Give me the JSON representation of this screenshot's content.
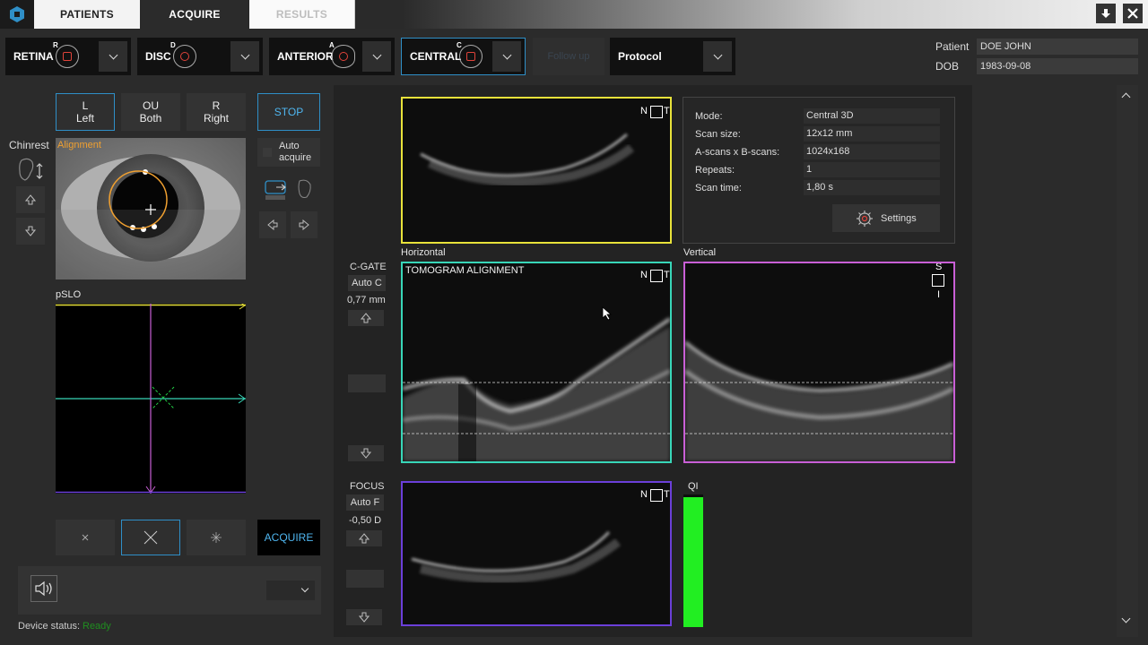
{
  "tabs": {
    "patients": "PATIENTS",
    "acquire": "ACQUIRE",
    "results": "RESULTS"
  },
  "modes": [
    {
      "label": "RETINA",
      "letter": "R"
    },
    {
      "label": "DISC",
      "letter": "D"
    },
    {
      "label": "ANTERIOR",
      "letter": "A"
    },
    {
      "label": "CENTRAL",
      "letter": "C"
    }
  ],
  "followup": "Follow up",
  "protocol": "Protocol",
  "patient": {
    "patient_label": "Patient",
    "patient_value": "DOE JOHN",
    "dob_label": "DOB",
    "dob_value": "1983-09-08"
  },
  "eye_select": [
    {
      "top": "L",
      "bottom": "Left"
    },
    {
      "top": "OU",
      "bottom": "Both"
    },
    {
      "top": "R",
      "bottom": "Right"
    }
  ],
  "stop": "STOP",
  "auto_acquire": "Auto\nacquire",
  "chinrest": "Chinrest",
  "alignment": "Alignment",
  "pslo": "pSLO",
  "acquire": "ACQUIRE",
  "device_status_label": "Device status:",
  "device_status_value": "Ready",
  "cgate": {
    "label": "C-GATE",
    "auto": "Auto C",
    "value": "0,77 mm"
  },
  "focus": {
    "label": "FOCUS",
    "auto": "Auto F",
    "value": "-0,50 D"
  },
  "horizontal": "Horizontal",
  "vertical": "Vertical",
  "tomogram_alignment": "TOMOGRAM ALIGNMENT",
  "qi": "QI",
  "qi_level": 0.98,
  "nt": {
    "n": "N",
    "t": "T",
    "s": "S",
    "i": "I"
  },
  "scan_info": [
    {
      "label": "Mode:",
      "value": "Central 3D"
    },
    {
      "label": "Scan size:",
      "value": "12x12 mm"
    },
    {
      "label": "A-scans x B-scans:",
      "value": "1024x168"
    },
    {
      "label": "Repeats:",
      "value": "1"
    },
    {
      "label": "Scan time:",
      "value": "1,80 s"
    }
  ],
  "settings": "Settings",
  "colors": {
    "accent": "#2f8fc7",
    "yellow": "#e8e23a",
    "cyan": "#38d6b8",
    "magenta": "#c95fd6",
    "purple": "#6b3fd9",
    "qi_green": "#22ee22",
    "status_green": "#1f8f1f"
  }
}
